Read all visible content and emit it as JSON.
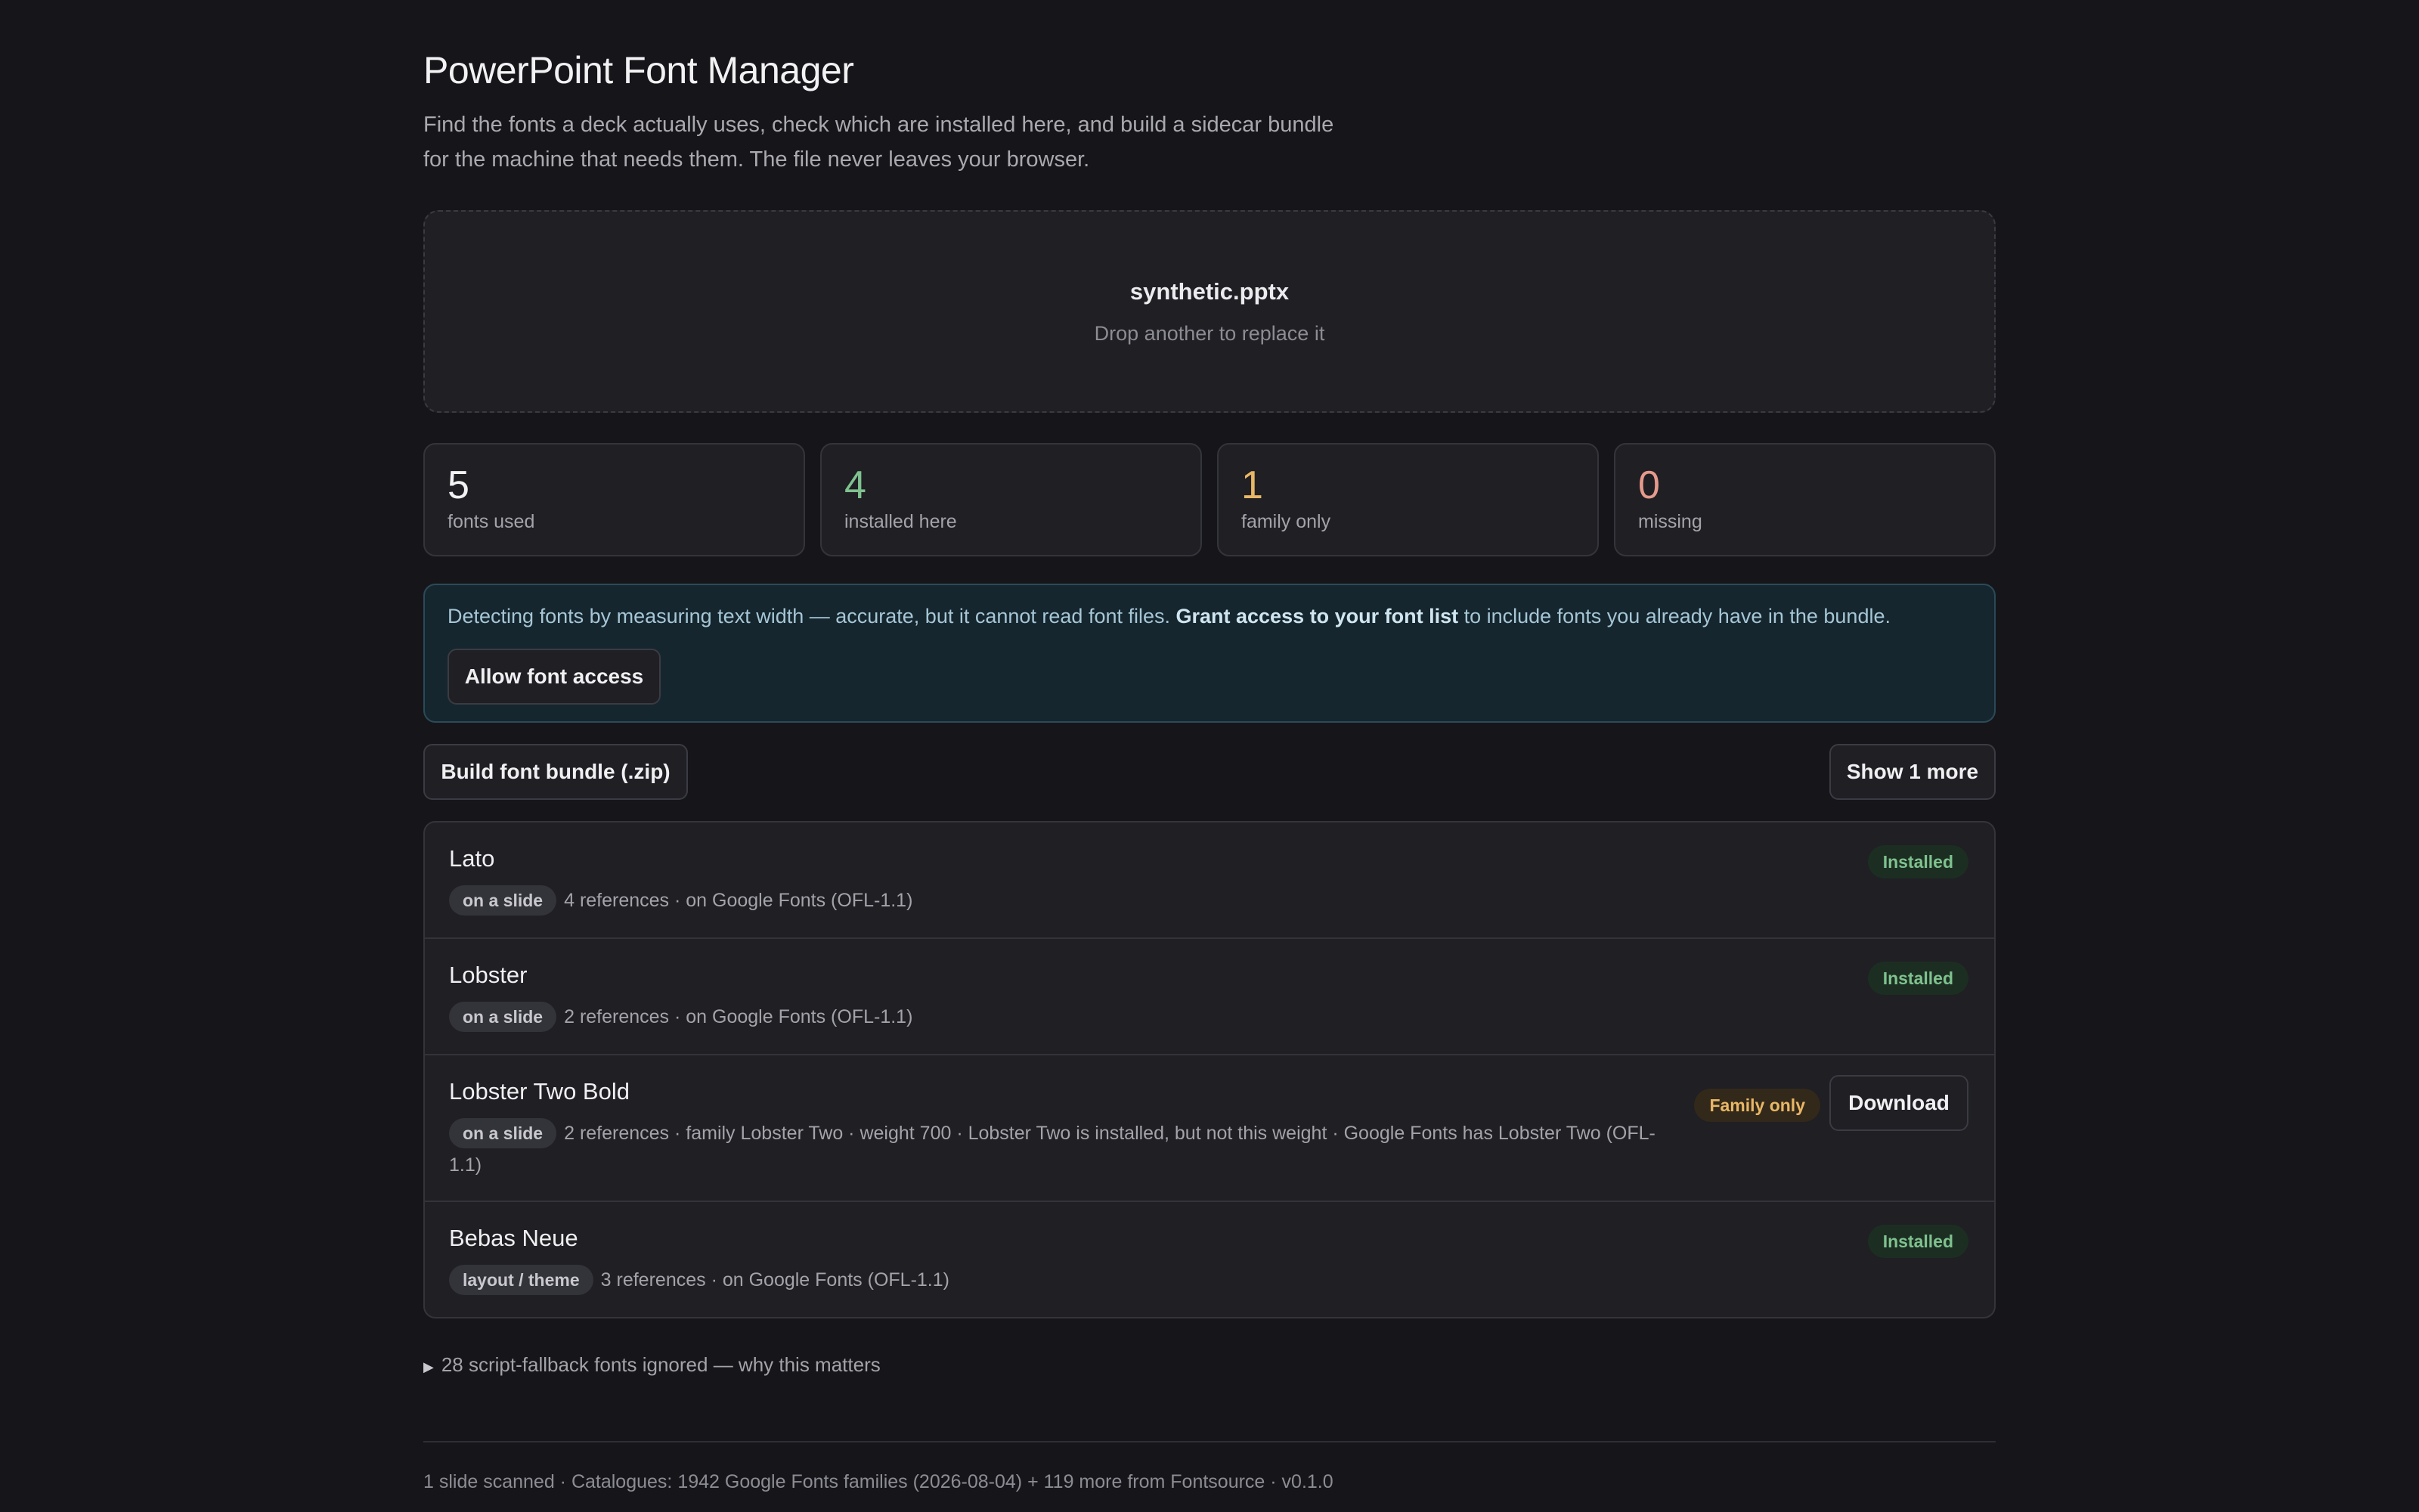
{
  "header": {
    "title": "PowerPoint Font Manager",
    "description": "Find the fonts a deck actually uses, check which are installed here, and build a sidecar bundle for the machine that needs them. The file never leaves your browser."
  },
  "dropzone": {
    "filename": "synthetic.pptx",
    "hint": "Drop another to replace it"
  },
  "stats": [
    {
      "value": "5",
      "label": "fonts used",
      "color": "#f2f2f4"
    },
    {
      "value": "4",
      "label": "installed here",
      "color": "#7fc28e"
    },
    {
      "value": "1",
      "label": "family only",
      "color": "#e8b766"
    },
    {
      "value": "0",
      "label": "missing",
      "color": "#e59a8c"
    }
  ],
  "notice": {
    "text_before": "Detecting fonts by measuring text width — accurate, but it cannot read font files. ",
    "text_link": "Grant access to your font list",
    "text_after": " to include fonts you already have in the bundle.",
    "button_label": "Allow font access"
  },
  "toolbar": {
    "build_label": "Build font bundle (.zip)",
    "show_more_label": "Show 1 more"
  },
  "fonts": [
    {
      "name": "Lato",
      "chip": "on a slide",
      "meta": "4 references · on Google Fonts (OFL-1.1)",
      "status": "Installed"
    },
    {
      "name": "Lobster",
      "chip": "on a slide",
      "meta": "2 references · on Google Fonts (OFL-1.1)",
      "status": "Installed"
    },
    {
      "name": "Lobster Two Bold",
      "chip": "on a slide",
      "meta": "2 references · family Lobster Two · weight 700 · Lobster Two is installed, but not this weight · Google Fonts has Lobster Two (OFL-1.1)",
      "status": "Family only",
      "action": "Download"
    },
    {
      "name": "Bebas Neue",
      "chip": "layout / theme",
      "meta": "3 references · on Google Fonts (OFL-1.1)",
      "status": "Installed"
    }
  ],
  "fallback": {
    "summary": "28 script-fallback fonts ignored — why this matters"
  },
  "footer": {
    "text": "1 slide scanned · Catalogues: 1942 Google Fonts families (2026-08-04) + 119 more from Fontsource · v0.1.0"
  }
}
